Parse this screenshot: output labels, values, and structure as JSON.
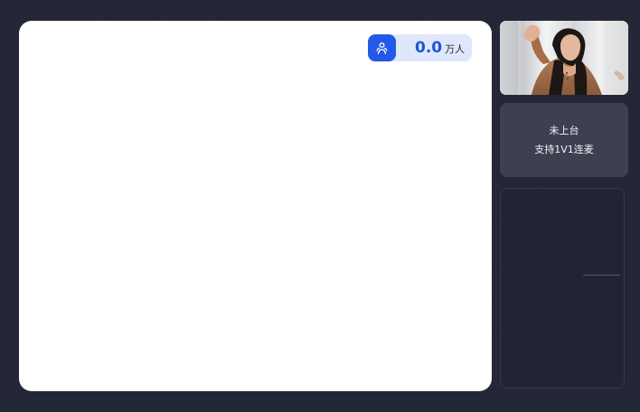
{
  "viewer": {
    "count": "0.0",
    "unit": "万人",
    "icon": "users-icon"
  },
  "seat": {
    "status": "未上台",
    "support": "支持1V1连麦"
  },
  "colors": {
    "background": "#222636",
    "stage": "#ffffff",
    "accent": "#2458e6",
    "viewer_pill": "#dfe8fb",
    "seat_card": "#3e4051"
  }
}
